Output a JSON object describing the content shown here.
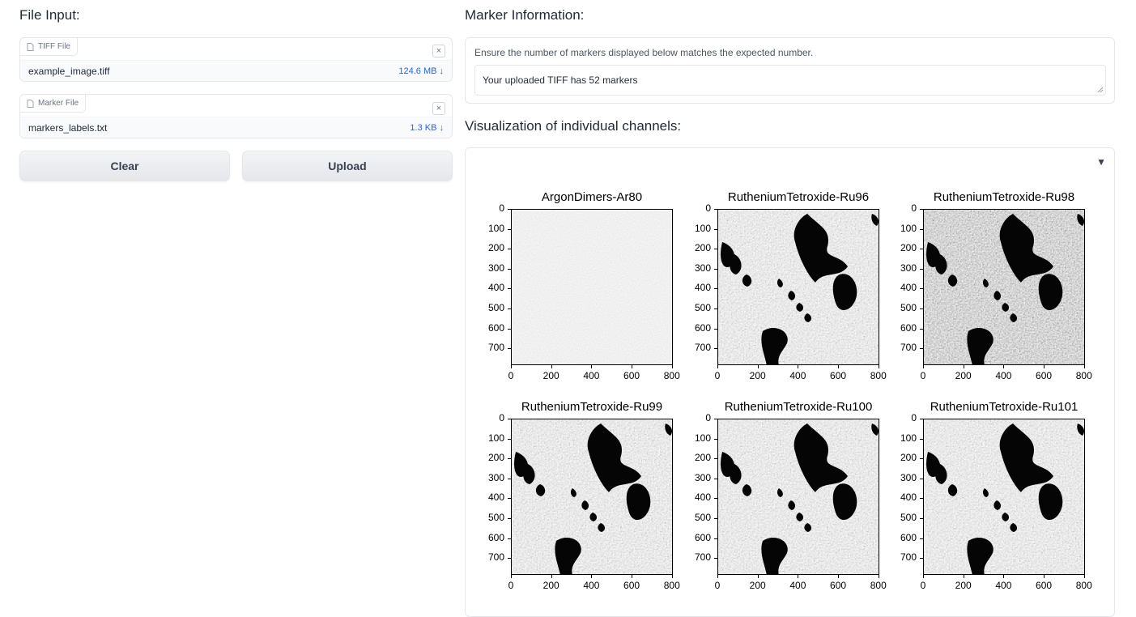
{
  "file_input": {
    "title": "File Input:",
    "tiff": {
      "tag": "TIFF File",
      "name": "example_image.tiff",
      "size": "124.6 MB ↓"
    },
    "marker": {
      "tag": "Marker File",
      "name": "markers_labels.txt",
      "size": "1.3 KB ↓"
    },
    "clear_label": "Clear",
    "upload_label": "Upload",
    "close_glyph": "×"
  },
  "marker_info": {
    "title": "Marker Information:",
    "label": "Ensure the number of markers displayed below matches the expected number.",
    "value": "Your uploaded TIFF has 52 markers"
  },
  "visualization": {
    "title": "Visualization of individual channels:",
    "toggle_glyph": "▼",
    "panels": [
      {
        "title": "ArgonDimers-Ar80",
        "style": "noise"
      },
      {
        "title": "RutheniumTetroxide-Ru96",
        "style": "tissue"
      },
      {
        "title": "RutheniumTetroxide-Ru98",
        "style": "tissue-dark"
      },
      {
        "title": "RutheniumTetroxide-Ru99",
        "style": "tissue"
      },
      {
        "title": "RutheniumTetroxide-Ru100",
        "style": "tissue"
      },
      {
        "title": "RutheniumTetroxide-Ru101",
        "style": "tissue"
      }
    ],
    "y_ticks": [
      "0",
      "100",
      "200",
      "300",
      "400",
      "500",
      "600",
      "700"
    ],
    "x_ticks": [
      "0",
      "200",
      "400",
      "600",
      "800"
    ]
  },
  "colors": {
    "accent_blue": "#2563eb",
    "border": "#e5e7eb"
  }
}
